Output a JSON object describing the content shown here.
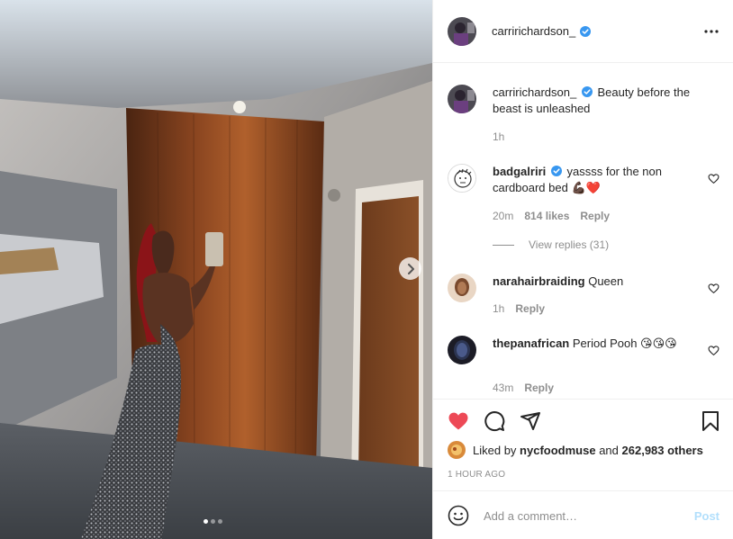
{
  "post": {
    "author": "carririchardson_",
    "author_verified": true,
    "carousel": {
      "slides": 3,
      "active_index": 0
    }
  },
  "caption": {
    "username": "carririchardson_",
    "text": "Beauty before the beast is unleashed",
    "time": "1h"
  },
  "comments": [
    {
      "username": "badgalriri",
      "verified": true,
      "text": "yassss for the non cardboard bed 💪🏿❤️",
      "time": "20m",
      "likes": "814 likes",
      "reply_label": "Reply",
      "view_replies": "View replies (31)"
    },
    {
      "username": "narahairbraiding",
      "verified": false,
      "text": "Queen",
      "time": "1h",
      "reply_label": "Reply"
    },
    {
      "username": "thepanafrican",
      "verified": false,
      "text": "Period Pooh 😘😘😘",
      "time": "43m",
      "reply_label": "Reply"
    }
  ],
  "actions": {
    "liked_by_prefix": "Liked by",
    "liked_by_user": "nycfoodmuse",
    "liked_by_and": "and",
    "others": "262,983 others",
    "timestamp": "1 HOUR AGO"
  },
  "comment_box": {
    "placeholder": "Add a comment…",
    "post_label": "Post"
  },
  "colors": {
    "like_red": "#ed4956",
    "verified_blue": "#3897f0",
    "post_button_disabled": "#b2dffc",
    "muted_text": "#8e8e8e"
  },
  "icons": [
    "chevron-right-icon",
    "more-options-icon",
    "verified-badge-icon",
    "heart-icon",
    "comment-icon",
    "share-icon",
    "bookmark-icon",
    "emoji-icon"
  ]
}
